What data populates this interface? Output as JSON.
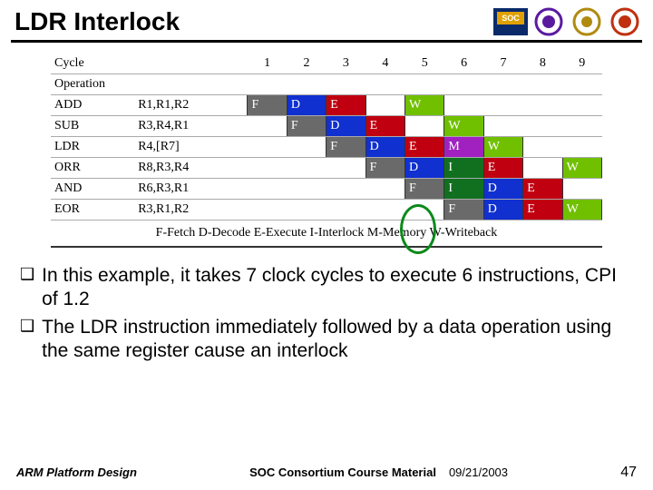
{
  "title": "LDR Interlock",
  "logos": [
    {
      "name": "soc-consortium-logo",
      "bg": "#0a2a6a",
      "inner": "#e0a000",
      "text": "SOC"
    },
    {
      "name": "org-logo-1",
      "bg": "#fff",
      "ring": "#5a1aa0"
    },
    {
      "name": "org-logo-2",
      "bg": "#fff",
      "ring": "#b08a10"
    },
    {
      "name": "org-logo-3",
      "bg": "#fff",
      "ring": "#c03010"
    }
  ],
  "chart_data": {
    "type": "table",
    "title": "Pipeline stage occupancy per cycle",
    "xlabel": "Cycle",
    "headers": {
      "cycle_label": "Cycle",
      "op_label": "Operation"
    },
    "cycles": [
      "1",
      "2",
      "3",
      "4",
      "5",
      "6",
      "7",
      "8",
      "9"
    ],
    "legend": {
      "F": "Fetch",
      "D": "Decode",
      "E": "Execute",
      "I": "Interlock",
      "M": "Memory",
      "W": "Writeback"
    },
    "rows": [
      {
        "instr": "ADD",
        "regs": "R1,R1,R2",
        "stages": [
          "F",
          "D",
          "E",
          "",
          "W",
          "",
          "",
          "",
          ""
        ]
      },
      {
        "instr": "SUB",
        "regs": "R3,R4,R1",
        "stages": [
          "",
          "F",
          "D",
          "E",
          "",
          "W",
          "",
          "",
          ""
        ]
      },
      {
        "instr": "LDR",
        "regs": "R4,[R7]",
        "stages": [
          "",
          "",
          "F",
          "D",
          "E",
          "M",
          "W",
          "",
          ""
        ]
      },
      {
        "instr": "ORR",
        "regs": "R8,R3,R4",
        "stages": [
          "",
          "",
          "",
          "F",
          "D",
          "I",
          "E",
          "",
          "W"
        ]
      },
      {
        "instr": "AND",
        "regs": "R6,R3,R1",
        "stages": [
          "",
          "",
          "",
          "",
          "F",
          "I",
          "D",
          "E",
          ""
        ]
      },
      {
        "instr": "EOR",
        "regs": "R3,R1,R2",
        "stages": [
          "",
          "",
          "",
          "",
          "",
          "F",
          "D",
          "E",
          "W"
        ]
      }
    ],
    "highlight": {
      "col": 6,
      "rows": [
        3,
        4
      ],
      "note": "interlock bubble"
    }
  },
  "legend_line": "F-Fetch    D-Decode    E-Execute    I-Interlock    M-Memory    W-Writeback",
  "bullets": [
    "In this example, it takes 7 clock cycles to execute 6 instructions, CPI of 1.2",
    "The LDR instruction immediately followed by a data operation using the same register cause an interlock"
  ],
  "footer": {
    "left": "ARM Platform Design",
    "mid": "SOC Consortium Course Material",
    "date": "09/21/2003",
    "page": "47"
  }
}
